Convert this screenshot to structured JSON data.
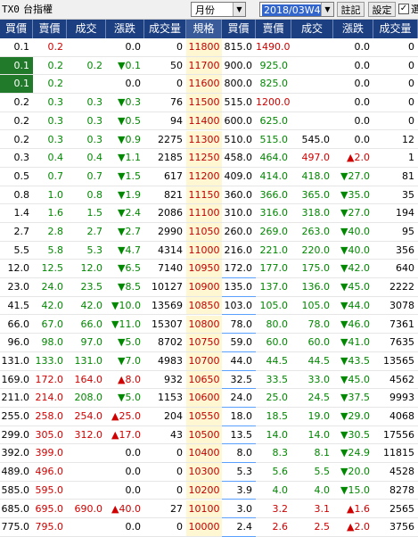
{
  "toolbar": {
    "code": "TX0",
    "name": "台指權",
    "period": "月份",
    "week": "2018/03W4",
    "notes_label": "註記",
    "settings_label": "設定",
    "checkbox_label": "選"
  },
  "columns": [
    "買價",
    "賣價",
    "成交",
    "漲跌",
    "成交量",
    "規格",
    "買價",
    "賣價",
    "成交",
    "漲跌",
    "成交量"
  ],
  "colors": {
    "header_bg": "#1c3f82",
    "up": "#d00000",
    "down": "#008800",
    "strike_bg": "#fff7d2",
    "highlight": "#217a2a"
  },
  "rows": [
    {
      "cb": "0.1",
      "cs": "0.2",
      "cl": "",
      "cc": "0.0",
      "cv": "0",
      "k": "11800",
      "pb": "815.0",
      "ps": "1490.0",
      "pl": "",
      "pc": "0.0",
      "pv": "0",
      "cb_box": false,
      "cl_color": "black",
      "cc_color": "black",
      "pl_color": "black",
      "pc_color": "black",
      "cs_color": "red",
      "ps_color": "red"
    },
    {
      "cb": "0.1",
      "cs": "0.2",
      "cl": "0.2",
      "cc": "▼0.1",
      "cv": "50",
      "k": "11700",
      "pb": "900.0",
      "ps": "925.0",
      "pl": "",
      "pc": "0.0",
      "pv": "0",
      "cb_box": true,
      "cl_color": "green",
      "cc_color": "green",
      "pl_color": "black",
      "pc_color": "black",
      "cs_color": "green",
      "ps_color": "green"
    },
    {
      "cb": "0.1",
      "cs": "0.2",
      "cl": "",
      "cc": "0.0",
      "cv": "0",
      "k": "11600",
      "pb": "800.0",
      "ps": "825.0",
      "pl": "",
      "pc": "0.0",
      "pv": "0",
      "cb_box": true,
      "cl_color": "black",
      "cc_color": "black",
      "pl_color": "black",
      "pc_color": "black",
      "cs_color": "green",
      "ps_color": "green"
    },
    {
      "cb": "0.2",
      "cs": "0.3",
      "cl": "0.3",
      "cc": "▼0.3",
      "cv": "76",
      "k": "11500",
      "pb": "515.0",
      "ps": "1200.0",
      "pl": "",
      "pc": "0.0",
      "pv": "0",
      "cb_box": false,
      "cl_color": "green",
      "cc_color": "green",
      "pl_color": "black",
      "pc_color": "black",
      "cs_color": "green",
      "ps_color": "red"
    },
    {
      "cb": "0.2",
      "cs": "0.3",
      "cl": "0.3",
      "cc": "▼0.5",
      "cv": "94",
      "k": "11400",
      "pb": "600.0",
      "ps": "625.0",
      "pl": "",
      "pc": "0.0",
      "pv": "0",
      "cb_box": false,
      "cl_color": "green",
      "cc_color": "green",
      "pl_color": "black",
      "pc_color": "black",
      "cs_color": "green",
      "ps_color": "green"
    },
    {
      "cb": "0.2",
      "cs": "0.3",
      "cl": "0.3",
      "cc": "▼0.9",
      "cv": "2275",
      "k": "11300",
      "pb": "510.0",
      "ps": "515.0",
      "pl": "545.0",
      "pc": "0.0",
      "pv": "12",
      "cb_box": false,
      "cl_color": "green",
      "cc_color": "green",
      "pl_color": "black",
      "pc_color": "black",
      "cs_color": "green",
      "ps_color": "green"
    },
    {
      "cb": "0.3",
      "cs": "0.4",
      "cl": "0.4",
      "cc": "▼1.1",
      "cv": "2185",
      "k": "11250",
      "pb": "458.0",
      "ps": "464.0",
      "pl": "497.0",
      "pc": "▲2.0",
      "pv": "1",
      "cb_box": false,
      "cl_color": "green",
      "cc_color": "green",
      "pl_color": "red",
      "pc_color": "red",
      "cs_color": "green",
      "ps_color": "green"
    },
    {
      "cb": "0.5",
      "cs": "0.7",
      "cl": "0.7",
      "cc": "▼1.5",
      "cv": "617",
      "k": "11200",
      "pb": "409.0",
      "ps": "414.0",
      "pl": "418.0",
      "pc": "▼27.0",
      "pv": "81",
      "cb_box": false,
      "cl_color": "green",
      "cc_color": "green",
      "pl_color": "green",
      "pc_color": "green",
      "cs_color": "green",
      "ps_color": "green"
    },
    {
      "cb": "0.8",
      "cs": "1.0",
      "cl": "0.8",
      "cc": "▼1.9",
      "cv": "821",
      "k": "11150",
      "pb": "360.0",
      "ps": "366.0",
      "pl": "365.0",
      "pc": "▼35.0",
      "pv": "35",
      "cb_box": false,
      "cl_color": "green",
      "cc_color": "green",
      "pl_color": "green",
      "pc_color": "green",
      "cs_color": "green",
      "ps_color": "green"
    },
    {
      "cb": "1.4",
      "cs": "1.6",
      "cl": "1.5",
      "cc": "▼2.4",
      "cv": "2086",
      "k": "11100",
      "pb": "310.0",
      "ps": "316.0",
      "pl": "318.0",
      "pc": "▼27.0",
      "pv": "194",
      "cb_box": false,
      "cl_color": "green",
      "cc_color": "green",
      "pl_color": "green",
      "pc_color": "green",
      "cs_color": "green",
      "ps_color": "green"
    },
    {
      "cb": "2.7",
      "cs": "2.8",
      "cl": "2.7",
      "cc": "▼2.7",
      "cv": "2990",
      "k": "11050",
      "pb": "260.0",
      "ps": "269.0",
      "pl": "263.0",
      "pc": "▼40.0",
      "pv": "95",
      "cb_box": false,
      "cl_color": "green",
      "cc_color": "green",
      "pl_color": "green",
      "pc_color": "green",
      "cs_color": "green",
      "ps_color": "green"
    },
    {
      "cb": "5.5",
      "cs": "5.8",
      "cl": "5.3",
      "cc": "▼4.7",
      "cv": "4314",
      "k": "11000",
      "pb": "216.0",
      "ps": "221.0",
      "pl": "220.0",
      "pc": "▼40.0",
      "pv": "356",
      "cb_box": false,
      "cl_color": "green",
      "cc_color": "green",
      "pl_color": "green",
      "pc_color": "green",
      "cs_color": "green",
      "ps_color": "green"
    },
    {
      "cb": "12.0",
      "cs": "12.5",
      "cl": "12.0",
      "cc": "▼6.5",
      "cv": "7140",
      "k": "10950",
      "pb": "172.0",
      "ps": "177.0",
      "pl": "175.0",
      "pc": "▼42.0",
      "pv": "640",
      "cb_box": false,
      "cl_color": "green",
      "cc_color": "green",
      "pl_color": "green",
      "pc_color": "green",
      "cs_color": "green",
      "ps_color": "green"
    },
    {
      "cb": "23.0",
      "cs": "24.0",
      "cl": "23.5",
      "cc": "▼8.5",
      "cv": "10127",
      "k": "10900",
      "pb": "135.0",
      "ps": "137.0",
      "pl": "136.0",
      "pc": "▼45.0",
      "pv": "2222",
      "cb_box": false,
      "cl_color": "green",
      "cc_color": "green",
      "pl_color": "green",
      "pc_color": "green",
      "cs_color": "green",
      "ps_color": "green"
    },
    {
      "cb": "41.5",
      "cs": "42.0",
      "cl": "42.0",
      "cc": "▼10.0",
      "cv": "13569",
      "k": "10850",
      "pb": "103.0",
      "ps": "105.0",
      "pl": "105.0",
      "pc": "▼44.0",
      "pv": "3078",
      "cb_box": false,
      "cl_color": "green",
      "cc_color": "green",
      "pl_color": "green",
      "pc_color": "green",
      "cs_color": "green",
      "ps_color": "green"
    },
    {
      "cb": "66.0",
      "cs": "67.0",
      "cl": "66.0",
      "cc": "▼11.0",
      "cv": "15307",
      "k": "10800",
      "pb": "78.0",
      "ps": "80.0",
      "pl": "78.0",
      "pc": "▼46.0",
      "pv": "7361",
      "cb_box": false,
      "cl_color": "green",
      "cc_color": "green",
      "pl_color": "green",
      "pc_color": "green",
      "cs_color": "green",
      "ps_color": "green"
    },
    {
      "cb": "96.0",
      "cs": "98.0",
      "cl": "97.0",
      "cc": "▼5.0",
      "cv": "8702",
      "k": "10750",
      "pb": "59.0",
      "ps": "60.0",
      "pl": "60.0",
      "pc": "▼41.0",
      "pv": "7635",
      "cb_box": false,
      "cl_color": "green",
      "cc_color": "green",
      "pl_color": "green",
      "pc_color": "green",
      "cs_color": "green",
      "ps_color": "green"
    },
    {
      "cb": "131.0",
      "cs": "133.0",
      "cl": "131.0",
      "cc": "▼7.0",
      "cv": "4983",
      "k": "10700",
      "pb": "44.0",
      "ps": "44.5",
      "pl": "44.5",
      "pc": "▼43.5",
      "pv": "13565",
      "cb_box": false,
      "cl_color": "green",
      "cc_color": "green",
      "pl_color": "green",
      "pc_color": "green",
      "cs_color": "green",
      "ps_color": "green"
    },
    {
      "cb": "169.0",
      "cs": "172.0",
      "cl": "164.0",
      "cc": "▲8.0",
      "cv": "932",
      "k": "10650",
      "pb": "32.5",
      "ps": "33.5",
      "pl": "33.0",
      "pc": "▼45.0",
      "pv": "4562",
      "cb_box": false,
      "cl_color": "red",
      "cc_color": "red",
      "pl_color": "green",
      "pc_color": "green",
      "cs_color": "red",
      "ps_color": "green"
    },
    {
      "cb": "211.0",
      "cs": "214.0",
      "cl": "208.0",
      "cc": "▼5.0",
      "cv": "1153",
      "k": "10600",
      "pb": "24.0",
      "ps": "25.0",
      "pl": "24.5",
      "pc": "▼37.5",
      "pv": "9993",
      "cb_box": false,
      "cl_color": "green",
      "cc_color": "green",
      "pl_color": "green",
      "pc_color": "green",
      "cs_color": "red",
      "ps_color": "green"
    },
    {
      "cb": "255.0",
      "cs": "258.0",
      "cl": "254.0",
      "cc": "▲25.0",
      "cv": "204",
      "k": "10550",
      "pb": "18.0",
      "ps": "18.5",
      "pl": "19.0",
      "pc": "▼29.0",
      "pv": "4068",
      "cb_box": false,
      "cl_color": "red",
      "cc_color": "red",
      "pl_color": "green",
      "pc_color": "green",
      "cs_color": "red",
      "ps_color": "green"
    },
    {
      "cb": "299.0",
      "cs": "305.0",
      "cl": "312.0",
      "cc": "▲17.0",
      "cv": "43",
      "k": "10500",
      "pb": "13.5",
      "ps": "14.0",
      "pl": "14.0",
      "pc": "▼30.5",
      "pv": "17556",
      "cb_box": false,
      "cl_color": "red",
      "cc_color": "red",
      "pl_color": "green",
      "pc_color": "green",
      "cs_color": "red",
      "ps_color": "green"
    },
    {
      "cb": "392.0",
      "cs": "399.0",
      "cl": "",
      "cc": "0.0",
      "cv": "0",
      "k": "10400",
      "pb": "8.0",
      "ps": "8.3",
      "pl": "8.1",
      "pc": "▼24.9",
      "pv": "11815",
      "cb_box": false,
      "cl_color": "black",
      "cc_color": "black",
      "pl_color": "green",
      "pc_color": "green",
      "cs_color": "red",
      "ps_color": "green"
    },
    {
      "cb": "489.0",
      "cs": "496.0",
      "cl": "",
      "cc": "0.0",
      "cv": "0",
      "k": "10300",
      "pb": "5.3",
      "ps": "5.6",
      "pl": "5.5",
      "pc": "▼20.0",
      "pv": "4528",
      "cb_box": false,
      "cl_color": "black",
      "cc_color": "black",
      "pl_color": "green",
      "pc_color": "green",
      "cs_color": "red",
      "ps_color": "green"
    },
    {
      "cb": "585.0",
      "cs": "595.0",
      "cl": "",
      "cc": "0.0",
      "cv": "0",
      "k": "10200",
      "pb": "3.9",
      "ps": "4.0",
      "pl": "4.0",
      "pc": "▼15.0",
      "pv": "8278",
      "cb_box": false,
      "cl_color": "black",
      "cc_color": "black",
      "pl_color": "green",
      "pc_color": "green",
      "cs_color": "red",
      "ps_color": "green"
    },
    {
      "cb": "685.0",
      "cs": "695.0",
      "cl": "690.0",
      "cc": "▲40.0",
      "cv": "27",
      "k": "10100",
      "pb": "3.0",
      "ps": "3.2",
      "pl": "3.1",
      "pc": "▲1.6",
      "pv": "2565",
      "cb_box": false,
      "cl_color": "red",
      "cc_color": "red",
      "pl_color": "red",
      "pc_color": "red",
      "cs_color": "red",
      "ps_color": "red"
    },
    {
      "cb": "775.0",
      "cs": "795.0",
      "cl": "",
      "cc": "0.0",
      "cv": "0",
      "k": "10000",
      "pb": "2.4",
      "ps": "2.6",
      "pl": "2.5",
      "pc": "▲2.0",
      "pv": "3756",
      "cb_box": false,
      "cl_color": "black",
      "cc_color": "black",
      "pl_color": "red",
      "pc_color": "red",
      "cs_color": "red",
      "ps_color": "red"
    }
  ]
}
